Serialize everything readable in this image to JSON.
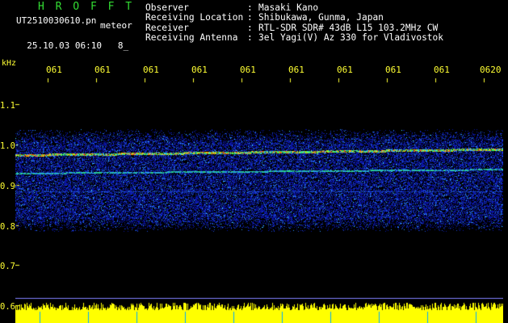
{
  "header": {
    "brand": "H R O F F T",
    "filename": "UT2510030610.pn",
    "tag": "meteor",
    "datetime": "25.10.03 06:10",
    "counter": "8_"
  },
  "meta": [
    {
      "key": "Observer",
      "value": "Masaki Kano"
    },
    {
      "key": "Receiving Location",
      "value": "Shibukawa, Gunma, Japan"
    },
    {
      "key": "Receiver",
      "value": "RTL-SDR SDR# 43dB L15 103.2MHz CW"
    },
    {
      "key": "Receiving Antenna",
      "value": "3el Yagi(V) Az 330 for Vladivostok"
    }
  ],
  "axis": {
    "unit": "kHz",
    "y_ticks": [
      "1.1",
      "1.0",
      "0.9",
      "0.8",
      "0.7",
      "0.6"
    ],
    "x_ticks": [
      "061",
      "061",
      "061",
      "061",
      "061",
      "061",
      "061",
      "061",
      "061",
      "0620"
    ]
  },
  "colors": {
    "background": "#000000",
    "noise_low": "#0000aa",
    "noise_mid": "#00ffff",
    "signal_hot": "#ff3300",
    "bottom_bar": "#ffff00",
    "marker": "#00aaff"
  }
}
